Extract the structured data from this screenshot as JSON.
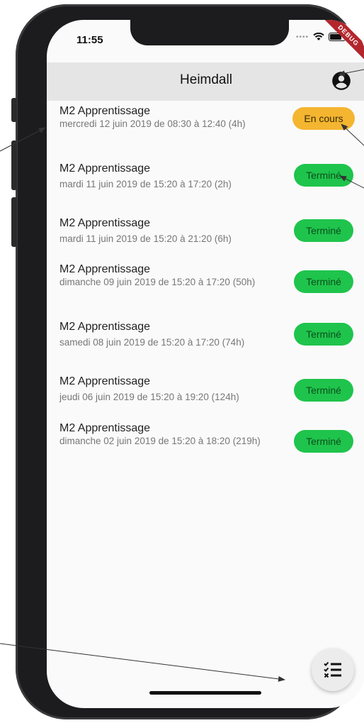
{
  "status": {
    "time": "11:55",
    "debug": "DEBUG"
  },
  "appbar": {
    "title": "Heimdall",
    "icon": "account-circle-icon"
  },
  "sessions": [
    {
      "title": "M2 Apprentissage",
      "subtitle": "mercredi 12 juin 2019 de 08:30 à 12:40 (4h)",
      "status": "En cours"
    },
    {
      "title": "M2 Apprentissage",
      "subtitle": "mardi 11 juin 2019 de 15:20 à 17:20 (2h)",
      "status": "Terminé"
    },
    {
      "title": "M2 Apprentissage",
      "subtitle": "mardi 11 juin 2019 de 15:20 à 21:20 (6h)",
      "status": "Terminé"
    },
    {
      "title": "M2 Apprentissage",
      "subtitle": "dimanche 09 juin 2019 de 15:20 à 17:20 (50h)",
      "status": "Terminé"
    },
    {
      "title": "M2 Apprentissage",
      "subtitle": "samedi 08 juin 2019 de 15:20 à 17:20 (74h)",
      "status": "Terminé"
    },
    {
      "title": "M2 Apprentissage",
      "subtitle": "jeudi 06 juin 2019 de 15:20 à 19:20 (124h)",
      "status": "Terminé"
    },
    {
      "title": "M2 Apprentissage",
      "subtitle": "dimanche 02 juin 2019 de 15:20 à 18:20 (219h)",
      "status": "Terminé"
    }
  ],
  "fab": {
    "icon": "checklist-icon"
  },
  "colors": {
    "done": "#1fc44c",
    "running": "#f4b531",
    "appbar": "#e5e5e5"
  }
}
